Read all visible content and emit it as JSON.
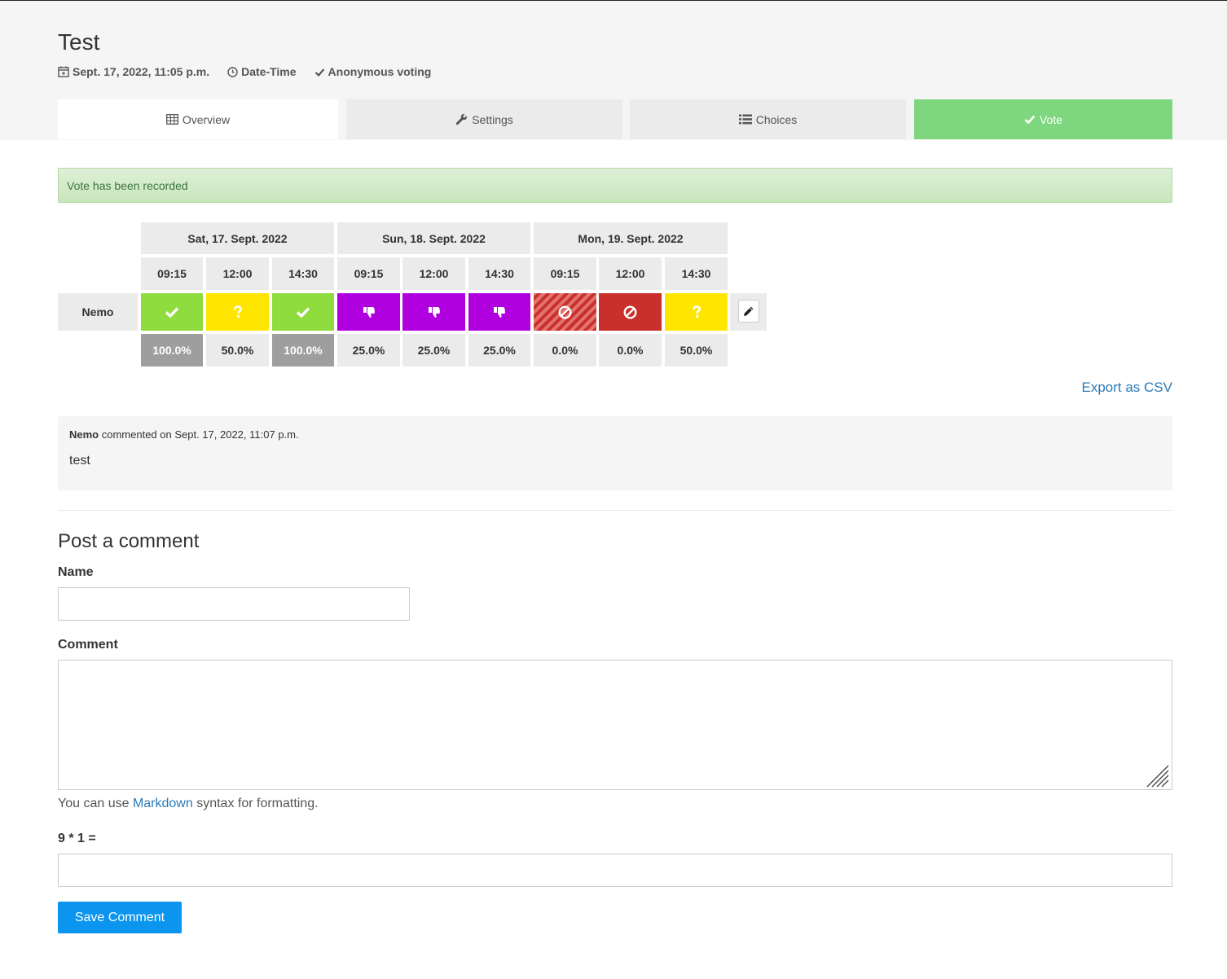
{
  "poll": {
    "title": "Test",
    "date": "Sept. 17, 2022, 11:05 p.m.",
    "type": "Date-Time",
    "voting": "Anonymous voting"
  },
  "tabs": {
    "overview": "Overview",
    "settings": "Settings",
    "choices": "Choices",
    "vote": "Vote"
  },
  "alert": "Vote has been recorded",
  "table": {
    "days": [
      "Sat, 17. Sept. 2022",
      "Sun, 18. Sept. 2022",
      "Mon, 19. Sept. 2022"
    ],
    "times": [
      "09:15",
      "12:00",
      "14:30",
      "09:15",
      "12:00",
      "14:30",
      "09:15",
      "12:00",
      "14:30"
    ],
    "voter": "Nemo",
    "votes": [
      "yes",
      "maybe",
      "yes",
      "no",
      "no",
      "no",
      "veto-striped",
      "veto",
      "maybe"
    ],
    "vote_glyphs": [
      "check-icon",
      "question-icon",
      "check-icon",
      "thumbs-down-icon",
      "thumbs-down-icon",
      "thumbs-down-icon",
      "ban-icon",
      "ban-icon",
      "question-icon"
    ],
    "scores": [
      "100.0%",
      "50.0%",
      "100.0%",
      "25.0%",
      "25.0%",
      "25.0%",
      "0.0%",
      "0.0%",
      "50.0%"
    ],
    "best": [
      true,
      false,
      true,
      false,
      false,
      false,
      false,
      false,
      false
    ]
  },
  "export_label": "Export as CSV",
  "comment": {
    "author": "Nemo",
    "meta": " commented on Sept. 17, 2022, 11:07 p.m.",
    "text": "test"
  },
  "form": {
    "heading": "Post a comment",
    "name_label": "Name",
    "name_value": "",
    "comment_label": "Comment",
    "comment_value": "",
    "help_prefix": "You can use ",
    "help_link": "Markdown",
    "help_suffix": " syntax for formatting.",
    "captcha_label": "9 * 1 =",
    "captcha_value": "",
    "submit": "Save Comment"
  },
  "colors": {
    "yes": "#8fdc3f",
    "maybe": "#ffe600",
    "no": "#b100e0",
    "veto": "#c9302c",
    "vote_tab": "#7ed67e",
    "button": "#0b95ef",
    "link": "#2a7ab9"
  }
}
